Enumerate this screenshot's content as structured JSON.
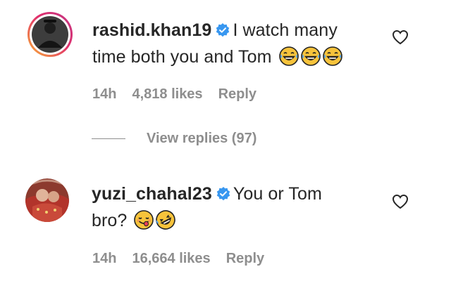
{
  "comments": [
    {
      "username": "rashid.khan19",
      "text_line1": "I watch many",
      "text_line2": "time both you and Tom",
      "emojis": [
        "tears-of-joy-emoji",
        "tears-of-joy-emoji",
        "tears-of-joy-emoji"
      ],
      "time": "14h",
      "likes": "4,818 likes",
      "reply": "Reply",
      "avatar_story_ring_colors": [
        "#f9b234",
        "#e1306c",
        "#c13584"
      ]
    },
    {
      "username": "yuzi_chahal23",
      "text_line1": "You or Tom",
      "text_line2": "bro?",
      "emojis": [
        "savoring-food-emoji",
        "rolling-laughing-emoji"
      ],
      "time": "14h",
      "likes": "16,664 likes",
      "reply": "Reply"
    }
  ],
  "view_replies": "View replies (97)",
  "colors": {
    "text": "#262626",
    "muted": "#8e8e8e",
    "verified": "#3897f0",
    "emoji_yellow": "#f7c33b"
  }
}
